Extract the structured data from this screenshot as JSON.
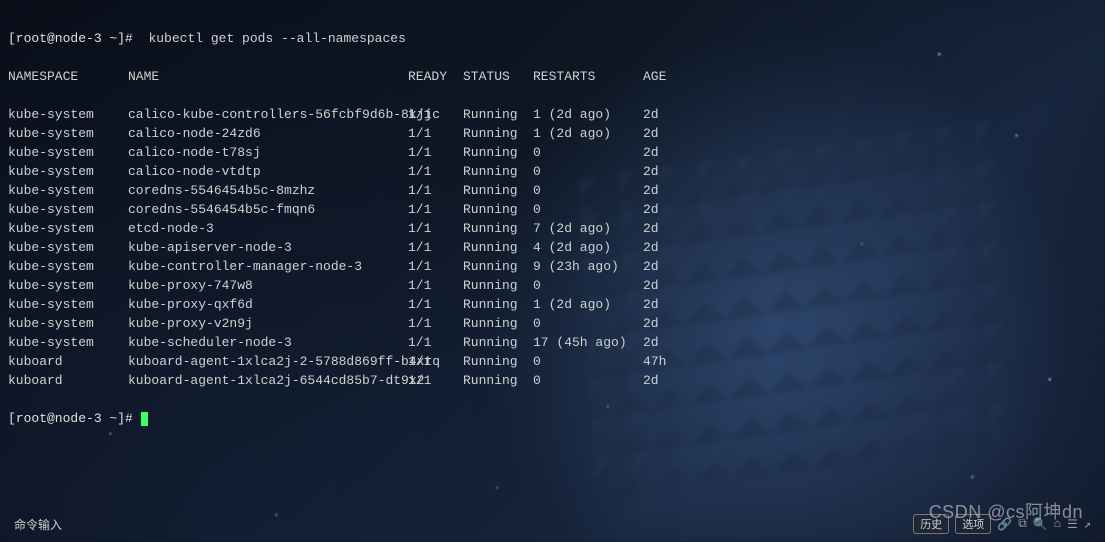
{
  "prompt": {
    "user_host": "[root@node-3 ~]#",
    "command": "kubectl get pods --all-namespaces"
  },
  "headers": {
    "namespace": "NAMESPACE",
    "name": "NAME",
    "ready": "READY",
    "status": "STATUS",
    "restarts": "RESTARTS",
    "age": "AGE"
  },
  "rows": [
    {
      "namespace": "kube-system",
      "name": "calico-kube-controllers-56fcbf9d6b-8kjjc",
      "ready": "1/1",
      "status": "Running",
      "restarts": "1 (2d ago)",
      "age": "2d"
    },
    {
      "namespace": "kube-system",
      "name": "calico-node-24zd6",
      "ready": "1/1",
      "status": "Running",
      "restarts": "1 (2d ago)",
      "age": "2d"
    },
    {
      "namespace": "kube-system",
      "name": "calico-node-t78sj",
      "ready": "1/1",
      "status": "Running",
      "restarts": "0",
      "age": "2d"
    },
    {
      "namespace": "kube-system",
      "name": "calico-node-vtdtp",
      "ready": "1/1",
      "status": "Running",
      "restarts": "0",
      "age": "2d"
    },
    {
      "namespace": "kube-system",
      "name": "coredns-5546454b5c-8mzhz",
      "ready": "1/1",
      "status": "Running",
      "restarts": "0",
      "age": "2d"
    },
    {
      "namespace": "kube-system",
      "name": "coredns-5546454b5c-fmqn6",
      "ready": "1/1",
      "status": "Running",
      "restarts": "0",
      "age": "2d"
    },
    {
      "namespace": "kube-system",
      "name": "etcd-node-3",
      "ready": "1/1",
      "status": "Running",
      "restarts": "7 (2d ago)",
      "age": "2d"
    },
    {
      "namespace": "kube-system",
      "name": "kube-apiserver-node-3",
      "ready": "1/1",
      "status": "Running",
      "restarts": "4 (2d ago)",
      "age": "2d"
    },
    {
      "namespace": "kube-system",
      "name": "kube-controller-manager-node-3",
      "ready": "1/1",
      "status": "Running",
      "restarts": "9 (23h ago)",
      "age": "2d"
    },
    {
      "namespace": "kube-system",
      "name": "kube-proxy-747w8",
      "ready": "1/1",
      "status": "Running",
      "restarts": "0",
      "age": "2d"
    },
    {
      "namespace": "kube-system",
      "name": "kube-proxy-qxf6d",
      "ready": "1/1",
      "status": "Running",
      "restarts": "1 (2d ago)",
      "age": "2d"
    },
    {
      "namespace": "kube-system",
      "name": "kube-proxy-v2n9j",
      "ready": "1/1",
      "status": "Running",
      "restarts": "0",
      "age": "2d"
    },
    {
      "namespace": "kube-system",
      "name": "kube-scheduler-node-3",
      "ready": "1/1",
      "status": "Running",
      "restarts": "17 (45h ago)",
      "age": "2d"
    },
    {
      "namespace": "kuboard",
      "name": "kuboard-agent-1xlca2j-2-5788d869ff-b4xrq",
      "ready": "1/1",
      "status": "Running",
      "restarts": "0",
      "age": "47h"
    },
    {
      "namespace": "kuboard",
      "name": "kuboard-agent-1xlca2j-6544cd85b7-dt9x2",
      "ready": "1/1",
      "status": "Running",
      "restarts": "0",
      "age": "2d"
    }
  ],
  "prompt2": {
    "user_host": "[root@node-3 ~]#"
  },
  "footer": {
    "input_hint": "命令输入",
    "history": "历史",
    "options": "选项"
  },
  "watermark": "CSDN @cs阿坤dn"
}
